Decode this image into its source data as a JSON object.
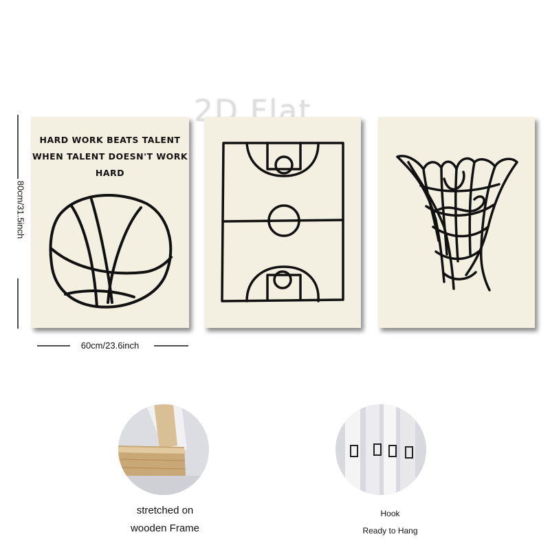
{
  "watermark": "2D Flat",
  "dimensions": {
    "height_label": "80cm/31.5inch",
    "width_label": "60cm/23.6inch"
  },
  "posters": {
    "ball": {
      "quote_lines": [
        "HARD WORK BEATS TALENT",
        "WHEN TALENT DOESN'T WORK",
        "HARD"
      ]
    }
  },
  "features": {
    "frame": {
      "caption_line1": "stretched on",
      "caption_line2": "wooden Frame"
    },
    "hook": {
      "caption_line1": "Hook",
      "caption_line2": "Ready to Hang"
    }
  },
  "colors": {
    "poster_bg": "#f3efe1",
    "ink": "#111111"
  }
}
